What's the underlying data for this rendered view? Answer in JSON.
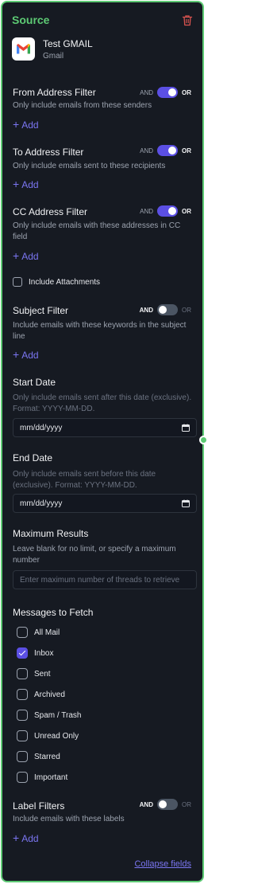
{
  "header": {
    "title": "Source"
  },
  "account": {
    "name": "Test GMAIL",
    "service": "Gmail"
  },
  "toggle_labels": {
    "and": "AND",
    "or": "OR"
  },
  "add_label": "Add",
  "from_filter": {
    "title": "From Address Filter",
    "desc": "Only include emails from these senders",
    "toggle": "on"
  },
  "to_filter": {
    "title": "To Address Filter",
    "desc": "Only include emails sent to these recipients",
    "toggle": "on"
  },
  "cc_filter": {
    "title": "CC Address Filter",
    "desc": "Only include emails with these addresses in CC field",
    "toggle": "on"
  },
  "attachments": {
    "label": "Include Attachments",
    "checked": false
  },
  "subject_filter": {
    "title": "Subject Filter",
    "desc": "Include emails with these keywords in the subject line",
    "toggle": "off"
  },
  "start_date": {
    "title": "Start Date",
    "desc": "Only include emails sent after this date (exclusive). Format: YYYY-MM-DD.",
    "value": "mm/dd/yyyy"
  },
  "end_date": {
    "title": "End Date",
    "desc": "Only include emails sent before this date (exclusive). Format: YYYY-MM-DD.",
    "value": "mm/dd/yyyy"
  },
  "max_results": {
    "title": "Maximum Results",
    "desc": "Leave blank for no limit, or specify a maximum number",
    "placeholder": "Enter maximum number of threads to retrieve"
  },
  "messages": {
    "title": "Messages to Fetch",
    "options": [
      {
        "label": "All Mail",
        "checked": false
      },
      {
        "label": "Inbox",
        "checked": true
      },
      {
        "label": "Sent",
        "checked": false
      },
      {
        "label": "Archived",
        "checked": false
      },
      {
        "label": "Spam / Trash",
        "checked": false
      },
      {
        "label": "Unread Only",
        "checked": false
      },
      {
        "label": "Starred",
        "checked": false
      },
      {
        "label": "Important",
        "checked": false
      }
    ]
  },
  "label_filters": {
    "title": "Label Filters",
    "desc": "Include emails with these labels",
    "toggle": "off"
  },
  "collapse_label": "Collapse fields",
  "colors": {
    "accent": "#5b4fe4",
    "border": "#5dca74",
    "link": "#7b76f2",
    "background": "#161a22"
  },
  "icons": {
    "delete": "trash-icon",
    "service": "gmail-logo-icon",
    "date": "calendar-icon",
    "check": "check-icon"
  }
}
